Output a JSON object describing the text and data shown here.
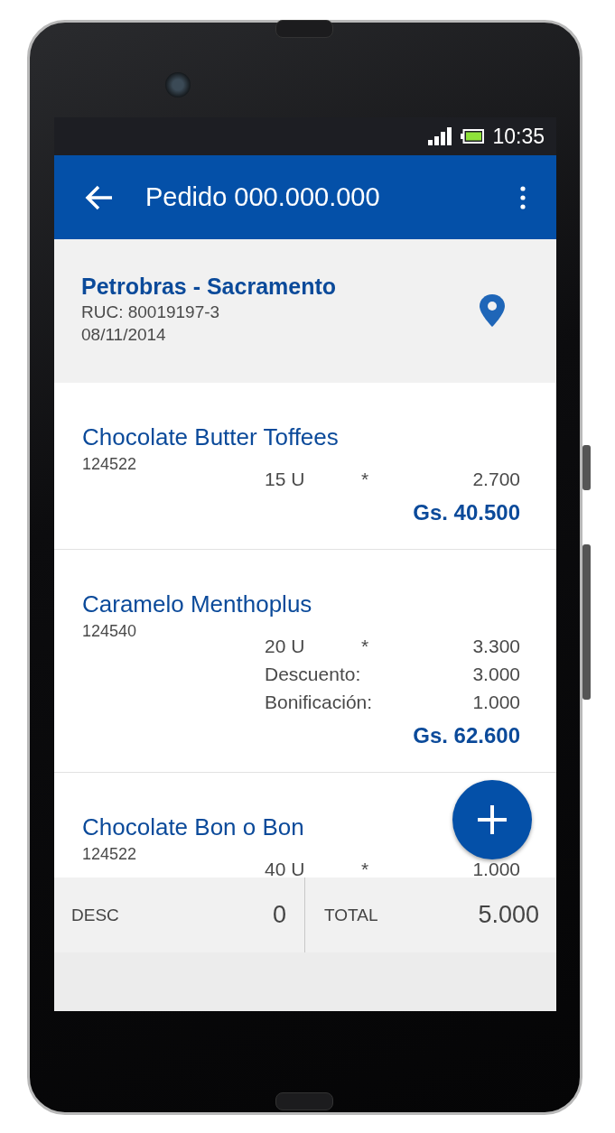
{
  "status_bar": {
    "time": "10:35"
  },
  "app_bar": {
    "title": "Pedido 000.000.000"
  },
  "customer": {
    "name": "Petrobras - Sacramento",
    "ruc": "RUC: 80019197-3",
    "date": "08/11/2014"
  },
  "items": [
    {
      "name": "Chocolate Butter Toffees",
      "code": "124522",
      "lines": [
        {
          "kind": "qty",
          "qty": "15 U",
          "op": "*",
          "value": "2.700"
        }
      ],
      "total": "Gs. 40.500"
    },
    {
      "name": "Caramelo Menthoplus",
      "code": "124540",
      "lines": [
        {
          "kind": "qty",
          "qty": "20 U",
          "op": "*",
          "value": "3.300"
        },
        {
          "kind": "label",
          "label": "Descuento:",
          "value": "3.000"
        },
        {
          "kind": "label",
          "label": "Bonificación:",
          "value": "1.000"
        }
      ],
      "total": "Gs. 62.600"
    },
    {
      "name": "Chocolate Bon o Bon",
      "code": "124522",
      "lines": [
        {
          "kind": "qty",
          "qty": "40 U",
          "op": "*",
          "value": "1.000"
        }
      ]
    }
  ],
  "footer": {
    "desc_label": "DESC",
    "desc_value": "0",
    "total_label": "TOTAL",
    "total_value": "5.000"
  }
}
